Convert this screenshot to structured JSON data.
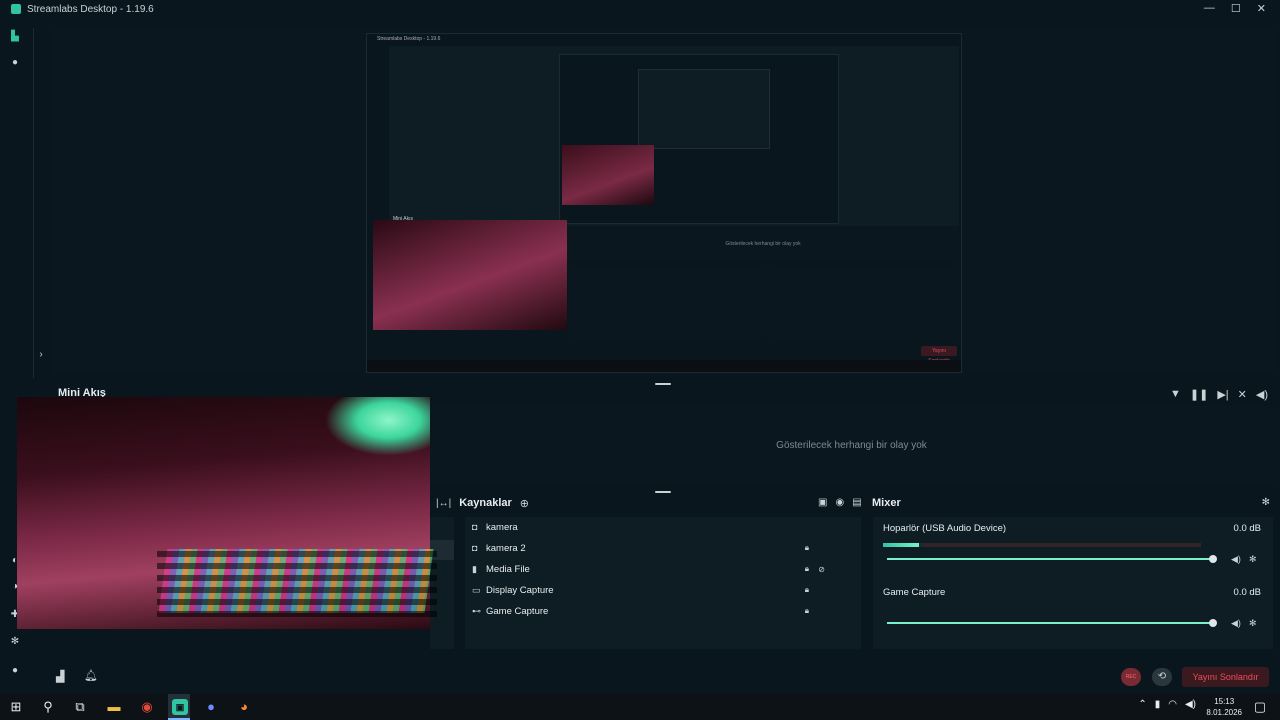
{
  "window": {
    "title": "Streamlabs Desktop - 1.19.6",
    "controls": {
      "minimize": "—",
      "maximize": "☐",
      "close": "✕"
    }
  },
  "nested_preview": {
    "title": "Streamlabs Desktop - 1.19.6",
    "mini_label": "Mini Akış",
    "events_empty": "Gösterilecek herhangi bir olay yok",
    "end_stream": "Yayını Sonlandır"
  },
  "mini_feed": {
    "label": "Mini Akış",
    "events_empty": "Gösterilecek herhangi bir olay yok"
  },
  "sources": {
    "title": "Kaynaklar",
    "items": [
      {
        "name": "kamera",
        "icon": "camera-icon",
        "locked": false
      },
      {
        "name": "kamera 2",
        "icon": "camera-icon",
        "locked": true
      },
      {
        "name": "Media File",
        "icon": "media-icon",
        "locked": true,
        "hidden": true
      },
      {
        "name": "Display Capture",
        "icon": "monitor-icon",
        "locked": true
      },
      {
        "name": "Game Capture",
        "icon": "gamepad-icon",
        "locked": true
      }
    ]
  },
  "mixer": {
    "title": "Mixer",
    "channels": [
      {
        "name": "Hoparlör (USB Audio Device)",
        "db": "0.0 dB",
        "level": 0.11,
        "volume": 1.0
      },
      {
        "name": "Game Capture",
        "db": "0.0 dB",
        "level": 0,
        "volume": 1.0
      }
    ]
  },
  "footer": {
    "rec_label": "REC",
    "end_stream": "Yayını Sonlandır"
  },
  "taskbar": {
    "time": "15:13",
    "date": "8.01.2026"
  },
  "colors": {
    "accent": "#31c3a2",
    "background": "#09161d",
    "panel": "#0e1c23",
    "danger": "#ef4b5a"
  }
}
